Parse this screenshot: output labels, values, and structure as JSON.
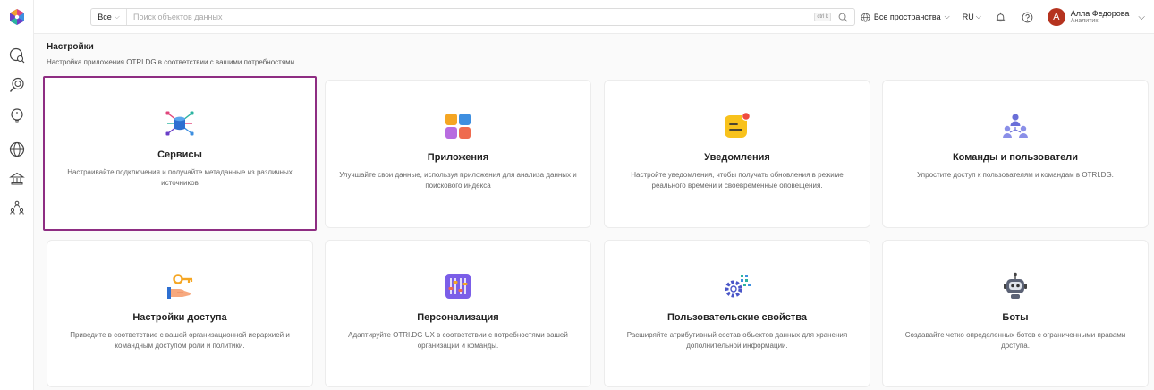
{
  "search": {
    "scope": "Все",
    "placeholder": "Поиск объектов данных",
    "shortcut": "ctrl k"
  },
  "header": {
    "domain": "Все пространства",
    "language": "RU",
    "user": {
      "initial": "А",
      "name": "Алла Федорова",
      "role": "Аналитик"
    }
  },
  "page": {
    "title": "Настройки",
    "subtitle": "Настройка приложения OTRI.DG в соответствии с вашими потребностями."
  },
  "cards": [
    {
      "title": "Сервисы",
      "description": "Настраивайте подключения и получайте метаданные из различных источников",
      "icon": "services-icon"
    },
    {
      "title": "Приложения",
      "description": "Улучшайте свои данные, используя приложения для анализа данных и поискового индекса",
      "icon": "apps-icon"
    },
    {
      "title": "Уведомления",
      "description": "Настройте уведомления, чтобы получать обновления в режиме реального времени и своевременные оповещения.",
      "icon": "notifications-icon"
    },
    {
      "title": "Команды и пользователи",
      "description": "Упростите доступ к пользователям и командам в OTRI.DG.",
      "icon": "teams-icon"
    },
    {
      "title": "Настройки доступа",
      "description": "Приведите в соответствие с вашей организационной иерархией и командным доступом роли и политики.",
      "icon": "access-key-icon"
    },
    {
      "title": "Персонализация",
      "description": "Адаптируйте OTRI.DG UX в соответствии с потребностями вашей организации и команды.",
      "icon": "customize-icon"
    },
    {
      "title": "Пользовательские свойства",
      "description": "Расширяйте атрибутивный состав объектов данных для хранения дополнительной информации.",
      "icon": "custom-properties-icon"
    },
    {
      "title": "Боты",
      "description": "Создавайте четко определенных ботов с ограниченными правами доступа.",
      "icon": "bots-icon"
    }
  ],
  "colors": {
    "selected_border": "#8e2d82",
    "avatar": "#b5331f"
  }
}
